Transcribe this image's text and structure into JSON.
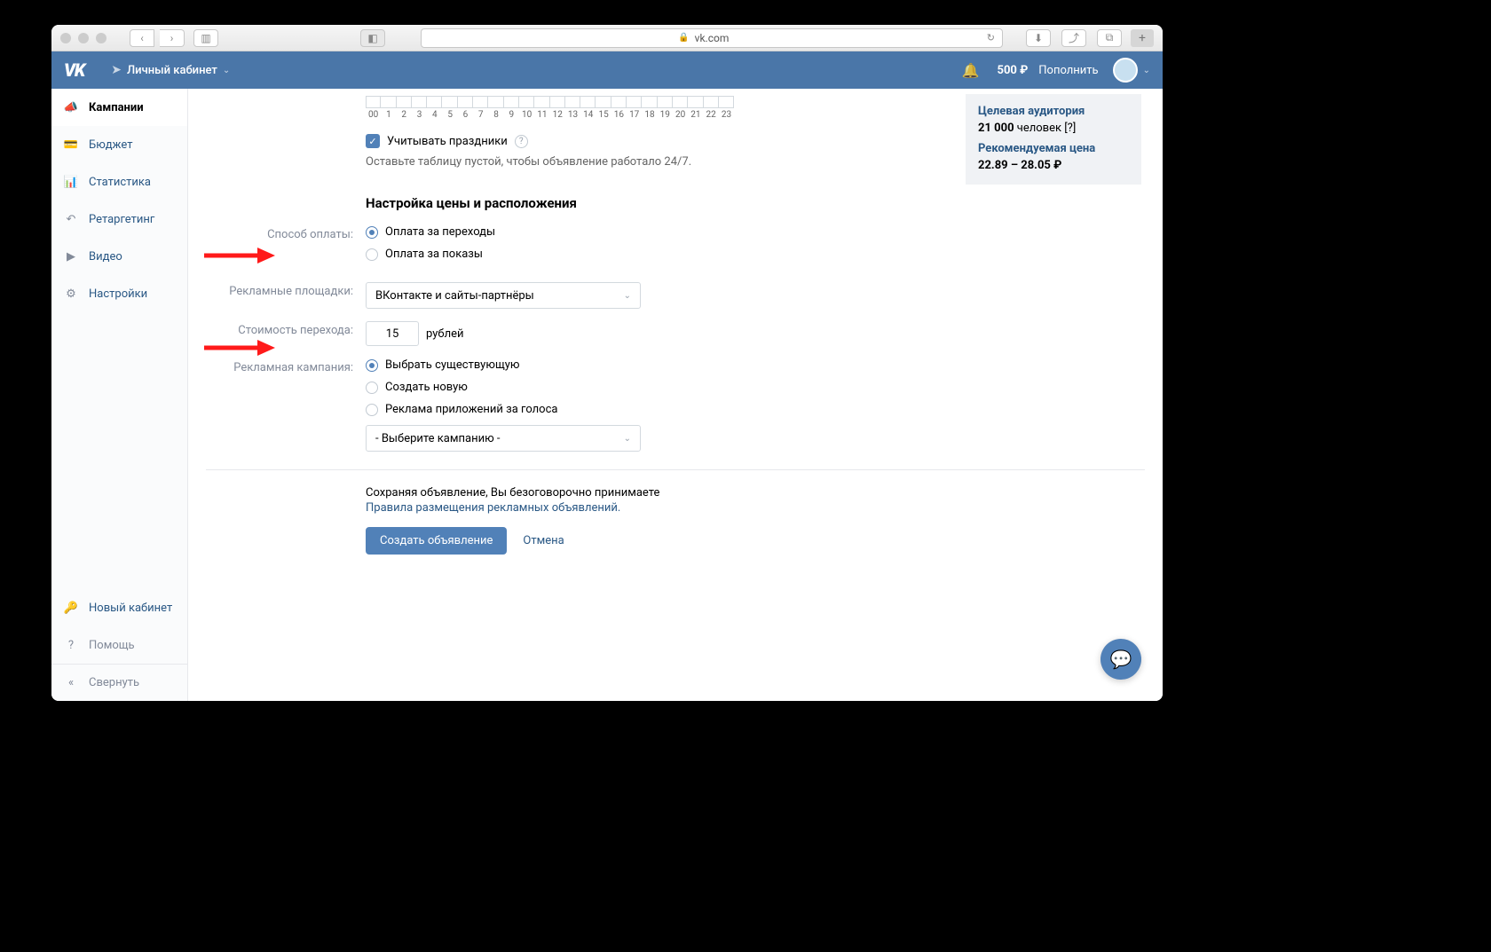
{
  "browser": {
    "url": "vk.com"
  },
  "header": {
    "cabinet": "Личный кабинет",
    "balance": "500 ₽",
    "topup": "Пополнить"
  },
  "sidebar": {
    "items": [
      {
        "label": "Кампании"
      },
      {
        "label": "Бюджет"
      },
      {
        "label": "Статистика"
      },
      {
        "label": "Ретаргетинг"
      },
      {
        "label": "Видео"
      },
      {
        "label": "Настройки"
      }
    ],
    "new_cabinet": "Новый кабинет",
    "help": "Помощь",
    "collapse": "Свернуть"
  },
  "panel": {
    "audience_title": "Целевая аудитория",
    "audience_count": "21 000",
    "audience_unit": "человек [?]",
    "price_title": "Рекомендуемая цена",
    "price_value": "22.89 – 28.05 ₽"
  },
  "hours": "00 1 2 3 4 5 6 7 8 9 10 11 12 13 14 15 16 17 18 19 20 21 22 23",
  "holidays_label": "Учитывать праздники",
  "empty_hint": "Оставьте таблицу пустой, чтобы объявление работало 24/7.",
  "section_title": "Настройка цены и расположения",
  "labels": {
    "payment": "Способ оплаты:",
    "platforms": "Рекламные площадки:",
    "cpc": "Стоимость перехода:",
    "campaign": "Рекламная кампания:"
  },
  "payment": {
    "clicks": "Оплата за переходы",
    "impressions": "Оплата за показы"
  },
  "platforms_select": "ВКонтакте и сайты-партнёры",
  "cpc_value": "15",
  "cpc_unit": "рублей",
  "campaign": {
    "existing": "Выбрать существующую",
    "new": "Создать новую",
    "voices": "Реклама приложений за голоса",
    "select": "- Выберите кампанию -"
  },
  "footer": {
    "accept": "Сохраняя объявление, Вы безоговорочно принимаете",
    "rules": "Правила размещения рекламных объявлений.",
    "create": "Создать объявление",
    "cancel": "Отмена"
  }
}
